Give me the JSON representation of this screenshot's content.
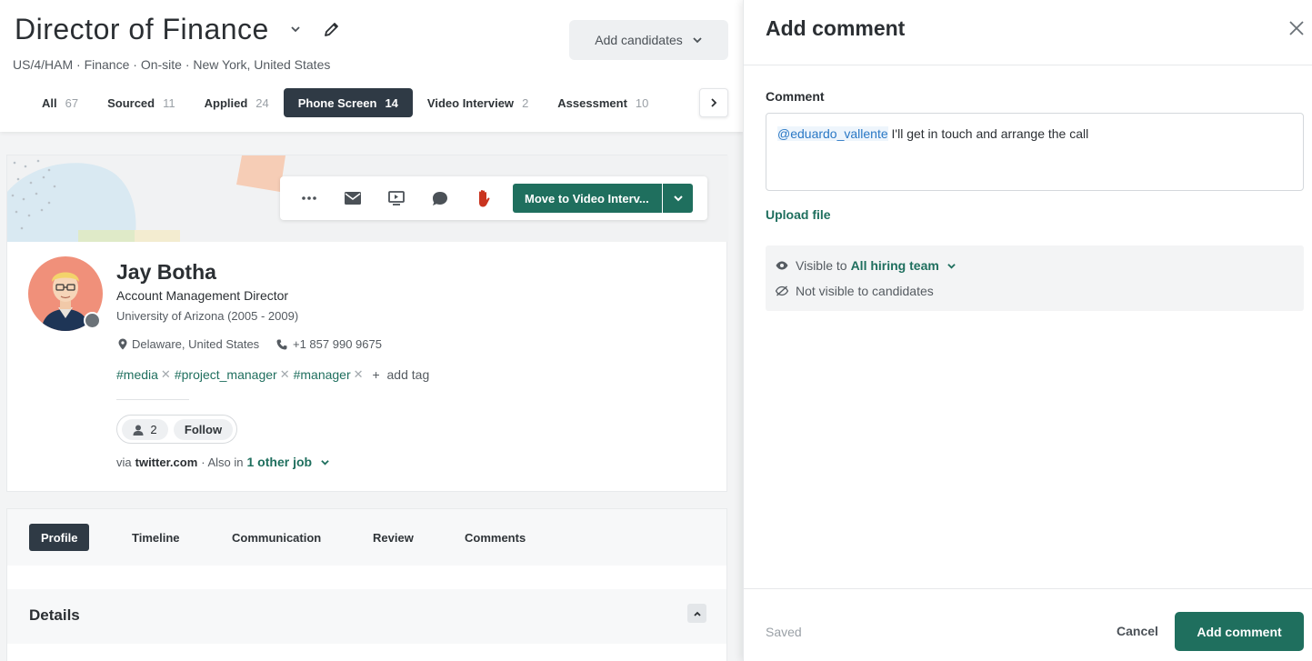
{
  "job": {
    "title": "Director of Finance",
    "meta": "US/4/HAM · Finance · On-site · New York, United States",
    "add_candidates_label": "Add candidates"
  },
  "stages": [
    {
      "label": "All",
      "count": "67"
    },
    {
      "label": "Sourced",
      "count": "11"
    },
    {
      "label": "Applied",
      "count": "24"
    },
    {
      "label": "Phone Screen",
      "count": "14",
      "active": true
    },
    {
      "label": "Video Interview",
      "count": "2"
    },
    {
      "label": "Assessment",
      "count": "10"
    }
  ],
  "actions": {
    "move_label": "Move to Video Interv..."
  },
  "candidate": {
    "name": "Jay Botha",
    "role": "Account Management Director",
    "education": "University of Arizona (2005 - 2009)",
    "location": "Delaware, United States",
    "phone": "+1 857 990 9675",
    "tags": [
      "#media",
      "#project_manager",
      "#manager"
    ],
    "add_tag_label": "add tag",
    "followers_count": "2",
    "follow_label": "Follow",
    "via_prefix": "via",
    "source": "twitter.com",
    "also_in": "· Also in",
    "other_job_link": "1 other job"
  },
  "profile_tabs": [
    "Profile",
    "Timeline",
    "Communication",
    "Review",
    "Comments"
  ],
  "details_title": "Details",
  "panel": {
    "title": "Add comment",
    "comment_label": "Comment",
    "mention": "@eduardo_vallente",
    "comment_text": " I'll get in touch and arrange the call",
    "upload_label": "Upload file",
    "visible_prefix": "Visible to",
    "visible_target": "All hiring team",
    "not_visible": "Not visible to candidates",
    "saved_label": "Saved",
    "cancel_label": "Cancel",
    "submit_label": "Add comment"
  },
  "colors": {
    "accent": "#1f6f5e",
    "dark": "#2f3a45",
    "mention": "#2a78c5"
  }
}
